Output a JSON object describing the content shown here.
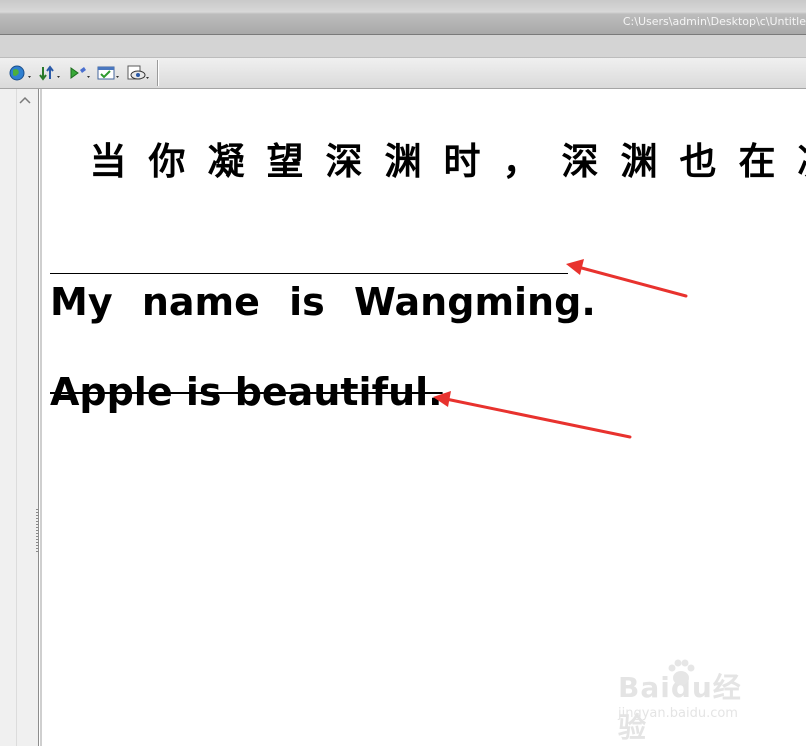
{
  "window": {
    "title": "C:\\Users\\admin\\Desktop\\c\\Untitle"
  },
  "toolbar": {
    "buttons": [
      {
        "icon": "globe-icon"
      },
      {
        "icon": "sort-arrows-icon"
      },
      {
        "icon": "debug-play-icon"
      },
      {
        "icon": "validate-markup-icon"
      },
      {
        "icon": "preview-eye-icon"
      }
    ]
  },
  "document": {
    "heading": "当你凝望深渊时，深渊也在凝视你",
    "paragraph1": "My name is Wangming.",
    "paragraph2": "Apple is beautiful."
  },
  "annotations": {
    "arrow_color": "#e8322e"
  },
  "watermark": {
    "brand": "Baidu经验",
    "url": "jingyan.baidu.com"
  }
}
